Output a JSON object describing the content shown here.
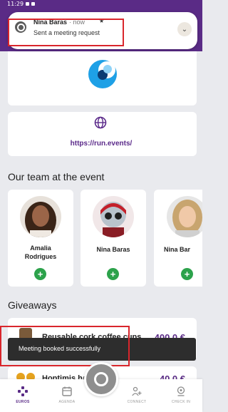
{
  "status_bar": {
    "time": "11:29"
  },
  "notification": {
    "sender": "Nina Baras",
    "meta": "· now",
    "message": "Sent a meeting request"
  },
  "event": {
    "link": "https://run.events/"
  },
  "team": {
    "title": "Our team at the event",
    "members": [
      {
        "name_line1": "Amalia",
        "name_line2": "Rodrigues"
      },
      {
        "name_line1": "Nina  Baras"
      },
      {
        "name_line1": "Nina Bar"
      }
    ]
  },
  "giveaways": {
    "title": "Giveaways",
    "items": [
      {
        "title": "Reusable cork coffee cups",
        "price": "400,0 €"
      },
      {
        "title": "Hoptimis ha",
        "price": "40,0 €"
      }
    ]
  },
  "toast": {
    "message": "Meeting booked successfully"
  },
  "bottom_nav": [
    {
      "label": "EUROS",
      "icon": "grid-icon",
      "active": true
    },
    {
      "label": "AGENDA",
      "icon": "calendar-icon"
    },
    {
      "label": "CONNECT",
      "icon": "people-icon"
    },
    {
      "label": "CHECK IN",
      "icon": "checkin-icon"
    }
  ],
  "colors": {
    "brand_purple": "#5a2b86",
    "add_green": "#2ca24b",
    "highlight_red": "#d9262c",
    "toast_bg": "#2d2d2d",
    "logo_blue": "#1ea0e6"
  }
}
